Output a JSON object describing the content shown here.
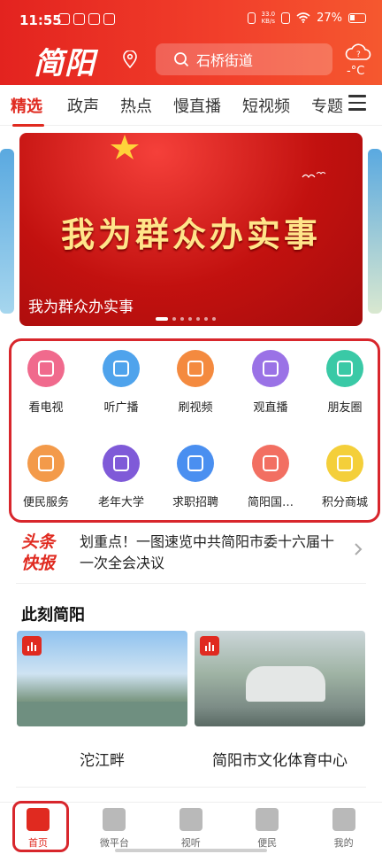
{
  "status_bar": {
    "time": "11:55",
    "network": "33.0\nKB/s",
    "battery": "27%"
  },
  "header": {
    "logo": "简阳",
    "search_text": "石桥街道",
    "weather": "-°C"
  },
  "tabs": [
    {
      "label": "精选",
      "active": true
    },
    {
      "label": "政声"
    },
    {
      "label": "热点"
    },
    {
      "label": "慢直播"
    },
    {
      "label": "短视频"
    },
    {
      "label": "专题"
    }
  ],
  "banner": {
    "headline": "我为群众办实事",
    "caption": "我为群众办实事",
    "slide_index": 1,
    "slide_count": 7
  },
  "services": [
    {
      "label": "看电视",
      "icon": "tv-icon",
      "color": "#f06a8d"
    },
    {
      "label": "听广播",
      "icon": "radio-icon",
      "color": "#4fa3ec"
    },
    {
      "label": "刷视频",
      "icon": "phone-video-icon",
      "color": "#f48a3f"
    },
    {
      "label": "观直播",
      "icon": "live-icon",
      "color": "#9a72e6"
    },
    {
      "label": "朋友圈",
      "icon": "aperture-icon",
      "color": "#3ac9a6"
    },
    {
      "label": "便民服务",
      "icon": "heart-hands-icon",
      "color": "#f39a4a"
    },
    {
      "label": "老年大学",
      "icon": "school-icon",
      "color": "#7f5ad8"
    },
    {
      "label": "求职招聘",
      "icon": "job-search-icon",
      "color": "#4a8ff0"
    },
    {
      "label": "简阳国…",
      "icon": "grid-apps-icon",
      "color": "#f26f62"
    },
    {
      "label": "积分商城",
      "icon": "coins-icon",
      "color": "#f4cf3a"
    }
  ],
  "headline_news": {
    "badge_line1": "头条",
    "badge_line2": "快报",
    "text": "划重点！一图速览中共简阳市委十六届十一次全会决议"
  },
  "section": {
    "title": "此刻简阳",
    "cards": [
      {
        "title": "沱江畔"
      },
      {
        "title": "简阳市文化体育中心"
      }
    ]
  },
  "bottom_nav": [
    {
      "label": "首页",
      "icon": "home-icon",
      "active": true
    },
    {
      "label": "微平台",
      "icon": "chat-icon"
    },
    {
      "label": "视听",
      "icon": "play-icon"
    },
    {
      "label": "便民",
      "icon": "bookmark-star-icon"
    },
    {
      "label": "我的",
      "icon": "person-icon"
    }
  ]
}
